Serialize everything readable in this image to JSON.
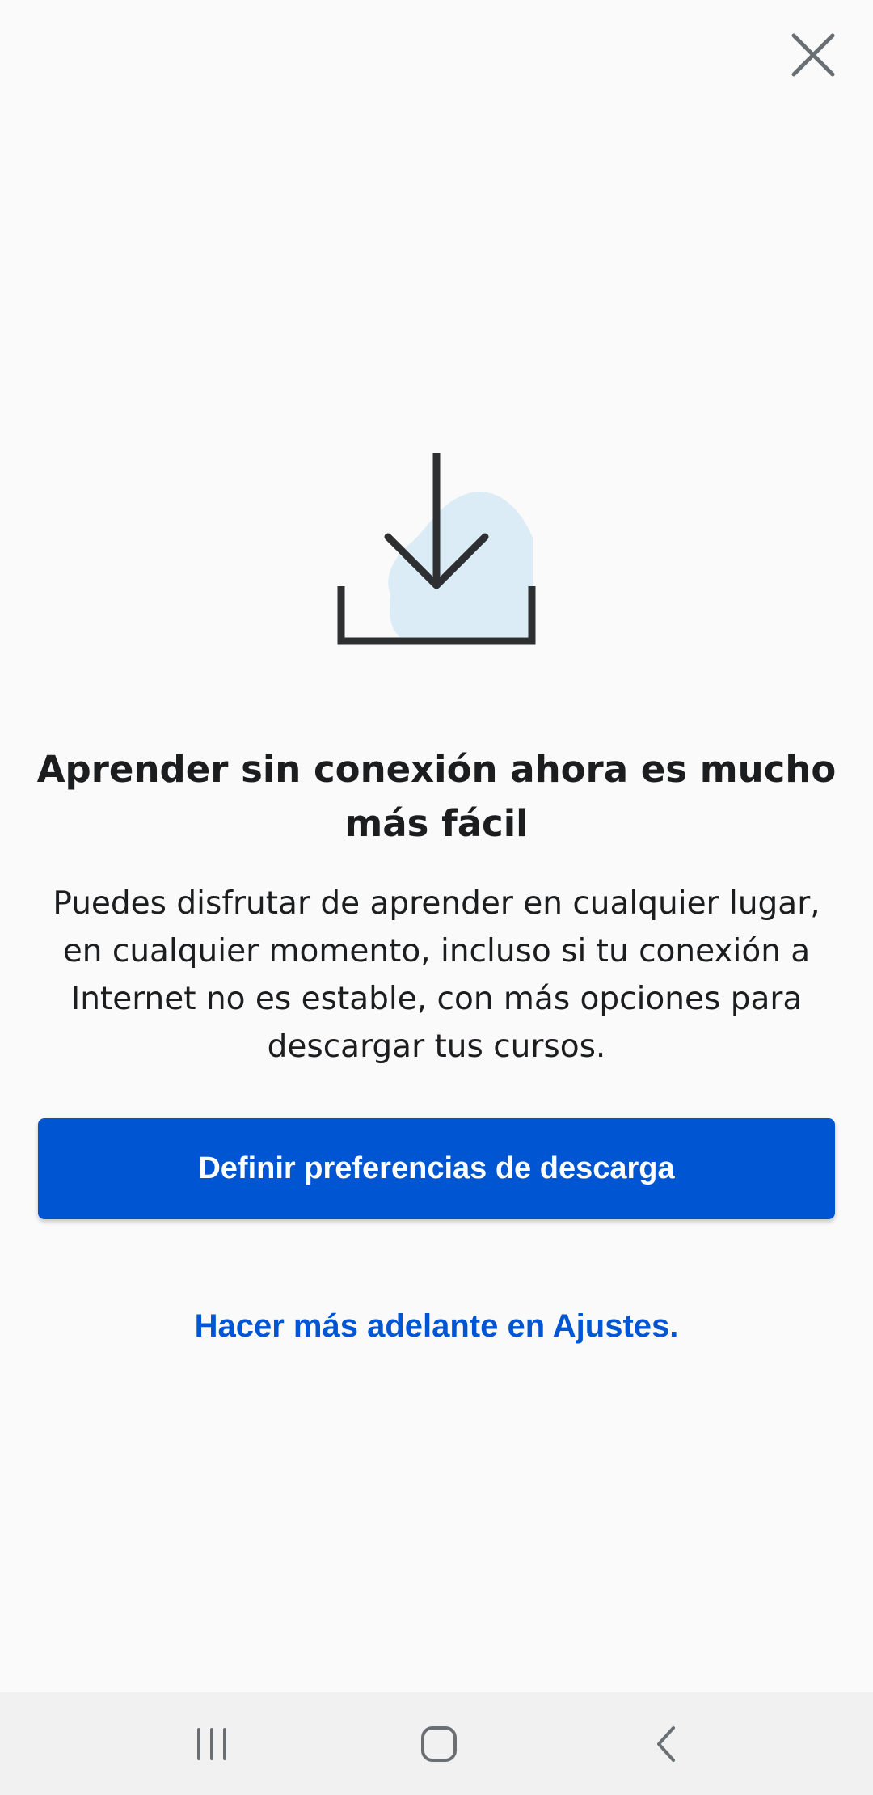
{
  "modal": {
    "close_icon": "close-icon",
    "hero_icon": "download-tray-icon",
    "title": "Aprender sin conexión ahora es mucho más fácil",
    "description": "Puedes disfrutar de aprender en cualquier lugar, en cualquier momento, incluso si tu conexión a Internet no es estable, con más opciones para descargar tus cursos.",
    "primary_button": "Definir preferencias de descarga",
    "secondary_link": "Hacer más adelante en Ajustes."
  },
  "system_nav": {
    "recents_icon": "recents-icon",
    "home_icon": "home-icon",
    "back_icon": "back-icon"
  },
  "colors": {
    "background": "#fafafa",
    "accent": "#0056d2",
    "text": "#1c1d1f",
    "icon_blob": "#dcecf7",
    "nav_bar": "#f1f1f1"
  }
}
